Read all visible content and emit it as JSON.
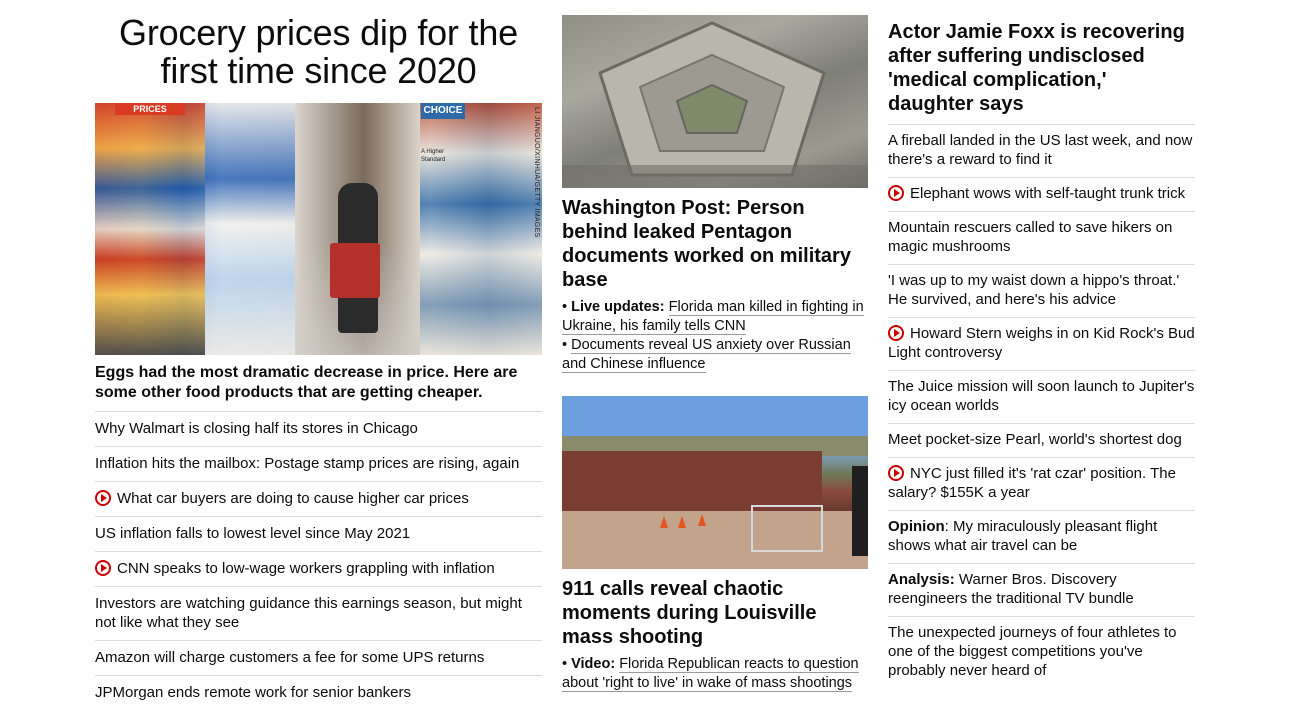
{
  "col1": {
    "headline": "Grocery prices dip for the first time since 2020",
    "image_credit": "LI JIANGUO/XINHUA/GETTY IMAGES",
    "image_signs": [
      "PRICES",
      "CHOICE",
      "A Higher Standard"
    ],
    "caption": "Eggs had the most dramatic decrease in price. Here are some other food products that are getting cheaper.",
    "items": [
      {
        "text": "Why Walmart is closing half its stores in Chicago",
        "video": false
      },
      {
        "text": "Inflation hits the mailbox: Postage stamp prices are rising, again",
        "video": false
      },
      {
        "text": "What car buyers are doing to cause higher car prices",
        "video": true
      },
      {
        "text": "US inflation falls to lowest level since May 2021",
        "video": false
      },
      {
        "text": "CNN speaks to low-wage workers grappling with inflation",
        "video": true
      },
      {
        "text": "Investors are watching guidance this earnings season, but might not like what they see",
        "video": false
      },
      {
        "text": "Amazon will charge customers a fee for some UPS returns",
        "video": false
      },
      {
        "text": "JPMorgan ends remote work for senior bankers",
        "video": false
      }
    ]
  },
  "col2": {
    "story1": {
      "title": "Washington Post: Person behind leaked Pentagon documents worked on military base",
      "sub1_label": "Live updates:",
      "sub1_text": "Florida man killed in fighting in Ukraine, his family tells CNN",
      "sub2_text": "Documents reveal US anxiety over Russian and Chinese influence"
    },
    "story2": {
      "title": "911 calls reveal chaotic moments during Louisville mass shooting",
      "sub1_label": "Video:",
      "sub1_text": "Florida Republican reacts to question about 'right to live' in wake of mass shootings"
    }
  },
  "col3": {
    "title": "Actor Jamie Foxx is recovering after suffering undisclosed 'medical complication,' daughter says",
    "items": [
      {
        "label": "",
        "text": "A fireball landed in the US last week, and now there's a reward to find it",
        "video": false
      },
      {
        "label": "",
        "text": "Elephant wows with self-taught trunk trick",
        "video": true
      },
      {
        "label": "",
        "text": "Mountain rescuers called to save hikers on magic mushrooms",
        "video": false
      },
      {
        "label": "",
        "text": "'I was up to my waist down a hippo's throat.' He survived, and here's his advice",
        "video": false
      },
      {
        "label": "",
        "text": "Howard Stern weighs in on Kid Rock's Bud Light controversy",
        "video": true
      },
      {
        "label": "",
        "text": "The Juice mission will soon launch to Jupiter's icy ocean worlds",
        "video": false
      },
      {
        "label": "",
        "text": "Meet pocket-size Pearl, world's shortest dog",
        "video": false
      },
      {
        "label": "",
        "text": "NYC just filled it's 'rat czar' position. The salary? $155K a year",
        "video": true
      },
      {
        "label": "Opinion",
        "text": ": My miraculously pleasant flight shows what air travel can be",
        "video": false
      },
      {
        "label": "Analysis:",
        "text": " Warner Bros. Discovery reengineers the traditional TV bundle",
        "video": false
      },
      {
        "label": "",
        "text": "The unexpected journeys of four athletes to one of the biggest competitions you've probably never heard of",
        "video": false
      }
    ]
  },
  "colors": {
    "text": "#0c0c0c",
    "divider": "#dcdcdc",
    "video_icon": "#cc0000"
  }
}
